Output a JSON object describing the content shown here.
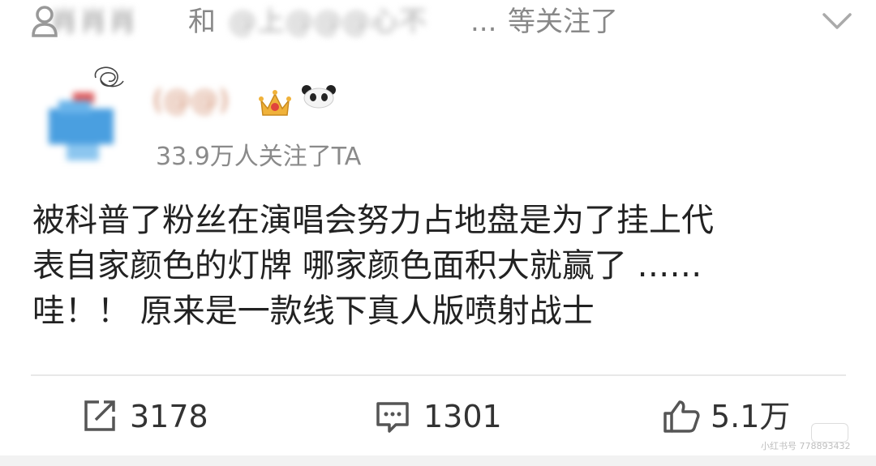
{
  "header": {
    "name_a": "肖肖肖",
    "conjunction": "和",
    "name_b": "@上@@@心不",
    "ellipsis": "...",
    "followed_suffix": "等关注了"
  },
  "author": {
    "username": "(@@)",
    "badges": [
      "crown-badge",
      "panda-badge"
    ],
    "follower_count": "33.9万人关注了TA"
  },
  "post": {
    "lines": [
      "被科普了粉丝在演唱会努力占地盘是为了挂上代",
      "表自家颜色的灯牌 哪家颜色面积大就赢了 ……",
      "哇！！ 原来是一款线下真人版喷射战士"
    ]
  },
  "actions": {
    "repost_count": "3178",
    "comment_count": "1301",
    "like_count": "5.1万"
  },
  "watermark": {
    "text": "小红书号 778893432"
  },
  "icons": [
    "user-icon",
    "chevron-down-icon",
    "repost-icon",
    "comment-icon",
    "like-icon"
  ],
  "colors": {
    "text": "#222222",
    "muted": "#8a8a8a",
    "divider": "#e8e8e8",
    "username": "#d08a6a"
  }
}
